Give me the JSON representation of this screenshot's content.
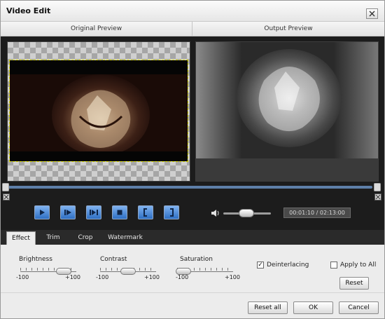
{
  "window": {
    "title": "Video Edit"
  },
  "preview": {
    "original_label": "Original Preview",
    "output_label": "Output Preview"
  },
  "playback": {
    "time_display": "00:01:10 / 02:13:00"
  },
  "tabs": [
    {
      "label": "Effect",
      "active": true
    },
    {
      "label": "Trim",
      "active": false
    },
    {
      "label": "Crop",
      "active": false
    },
    {
      "label": "Watermark",
      "active": false
    }
  ],
  "effect": {
    "brightness": {
      "label": "Brightness",
      "min": "-100",
      "max": "+100"
    },
    "contrast": {
      "label": "Contrast",
      "min": "-100",
      "max": "+100"
    },
    "saturation": {
      "label": "Saturation",
      "min": "-100",
      "max": "+100"
    },
    "deinterlacing": {
      "label": "Deinterlacing",
      "checked": true
    },
    "apply_to_all": {
      "label": "Apply to All",
      "checked": false
    },
    "reset_label": "Reset"
  },
  "footer": {
    "reset_all_label": "Reset all",
    "ok_label": "OK",
    "cancel_label": "Cancel"
  },
  "colors": {
    "accent": "#2e6fc4",
    "dark": "#1c1c1c",
    "timeline": "#5e7fa8"
  },
  "icons": [
    "close-icon",
    "play-icon",
    "step-play-icon",
    "frame-step-icon",
    "stop-icon",
    "mark-in-icon",
    "mark-out-icon",
    "volume-icon"
  ]
}
